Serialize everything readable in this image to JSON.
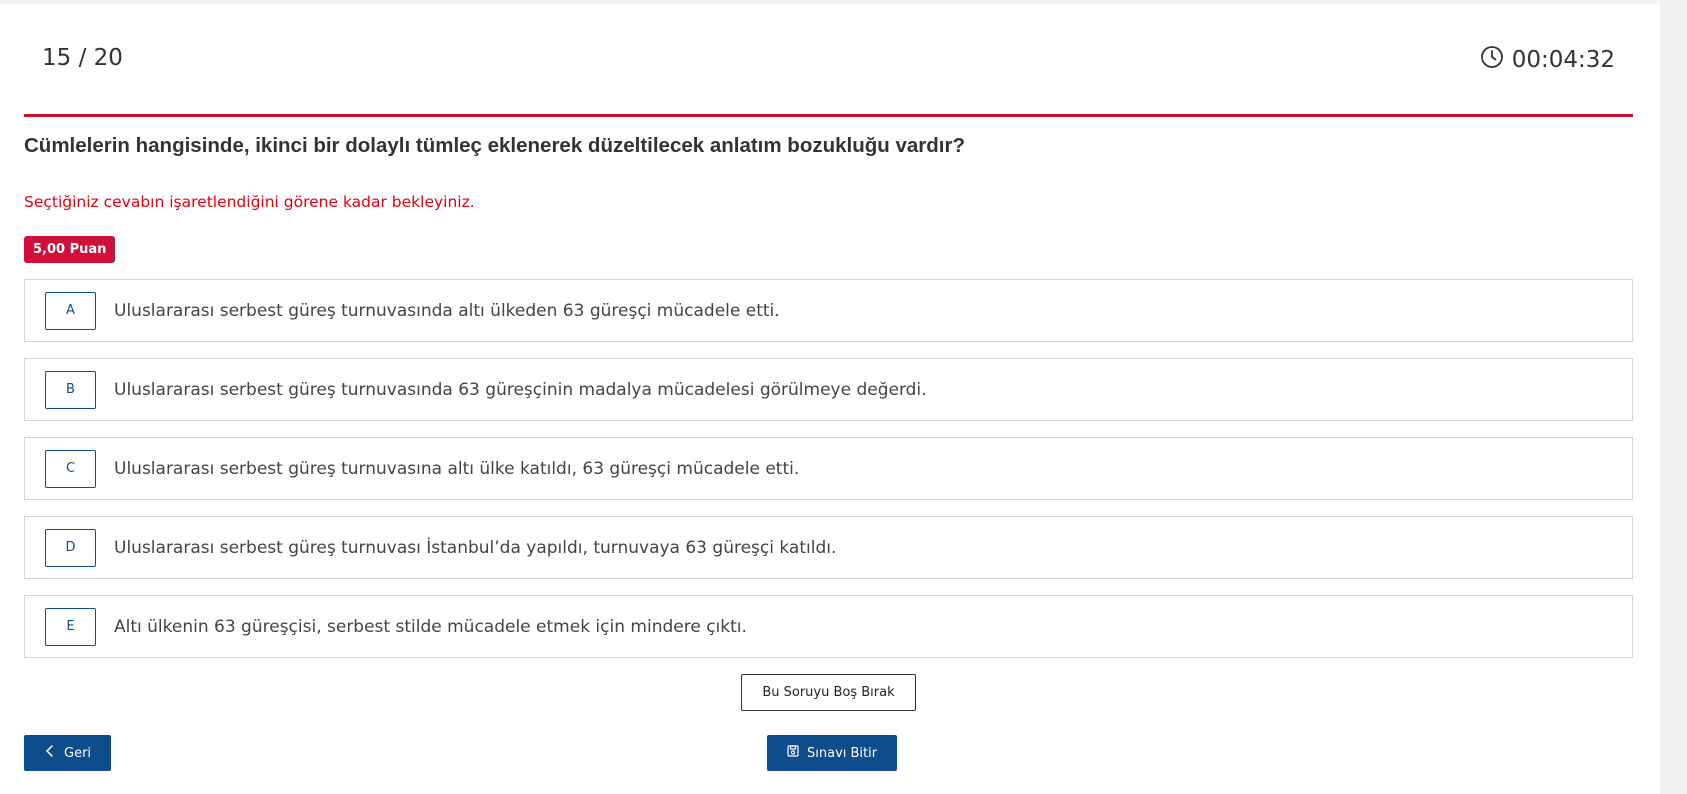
{
  "header": {
    "counter": "15 / 20",
    "timer": "00:04:32"
  },
  "question": {
    "text": "Cümlelerin hangisinde, ikinci bir dolaylı tümleç eklenerek düzeltilecek anlatım bozukluğu vardır?",
    "notice": "Seçtiğiniz cevabın işaretlendiğini görene kadar bekleyiniz.",
    "points": "5,00 Puan"
  },
  "options": [
    {
      "letter": "A",
      "text": "Uluslararası serbest güreş turnuvasında altı ülkeden 63 güreşçi mücadele etti."
    },
    {
      "letter": "B",
      "text": "Uluslararası serbest güreş turnuvasında 63 güreşçinin madalya mücadelesi görülmeye değerdi."
    },
    {
      "letter": "C",
      "text": "Uluslararası serbest güreş turnuvasına altı ülke katıldı, 63 güreşçi mücadele etti."
    },
    {
      "letter": "D",
      "text": "Uluslararası serbest güreş turnuvası İstanbul’da yapıldı, turnuvaya 63 güreşçi katıldı."
    },
    {
      "letter": "E",
      "text": "Altı ülkenin 63 güreşçisi, serbest stilde mücadele etmek için mindere çıktı."
    }
  ],
  "actions": {
    "skip_label": "Bu Soruyu Boş Bırak",
    "back_label": "Geri",
    "finish_label": "Sınavı Bitir"
  },
  "colors": {
    "accent_red": "#c8102e",
    "primary_blue": "#0e4c8c",
    "badge_red": "#d0103a"
  }
}
